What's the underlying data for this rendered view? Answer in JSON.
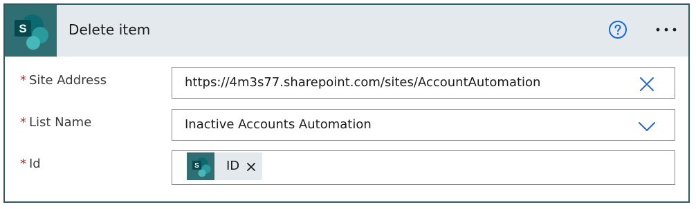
{
  "action": {
    "title": "Delete item",
    "app_icon": "sharepoint-icon",
    "accent_color": "#2f6f74",
    "header_bg": "#e3e9ec"
  },
  "fields": {
    "site_address": {
      "required_mark": "*",
      "label": "Site Address",
      "value": "https://4m3s77.sharepoint.com/sites/AccountAutomation",
      "icon": "clear-x-icon"
    },
    "list_name": {
      "required_mark": "*",
      "label": "List Name",
      "value": "Inactive Accounts Automation",
      "icon": "chevron-down-icon"
    },
    "id": {
      "required_mark": "*",
      "label": "Id",
      "token": {
        "text": "ID",
        "icon": "sharepoint-icon",
        "remove_icon": "close-icon"
      }
    }
  },
  "toolbar": {
    "help_icon": "help-circle-icon",
    "more_icon": "more-ellipsis-icon"
  }
}
